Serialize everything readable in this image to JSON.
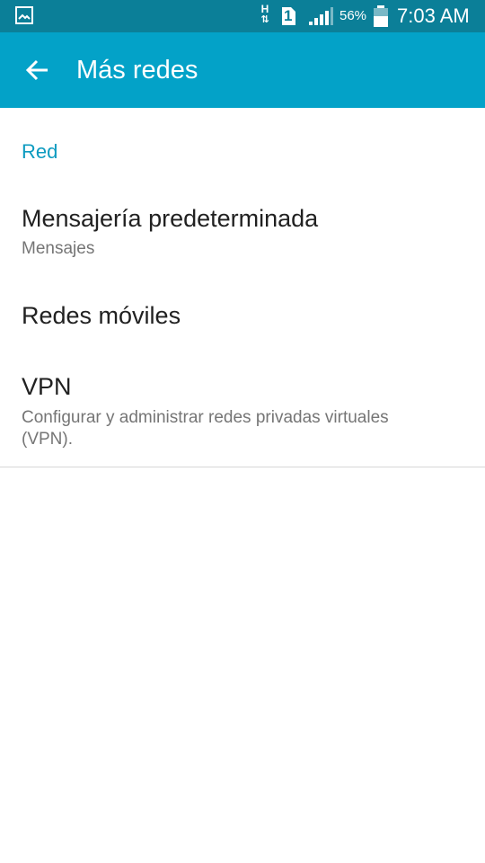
{
  "status_bar": {
    "left_icon": "gallery-notification-icon",
    "network_type": "H",
    "sim_slot": "1",
    "battery_percent": "56%",
    "time": "7:03 AM"
  },
  "app_bar": {
    "title": "Más redes",
    "back_icon": "arrow-left-icon"
  },
  "section": {
    "header": "Red"
  },
  "preferences": [
    {
      "title": "Mensajería predeterminada",
      "summary": "Mensajes"
    },
    {
      "title": "Redes móviles",
      "summary": ""
    },
    {
      "title": "VPN",
      "summary": "Configurar y administrar redes privadas virtuales (VPN)."
    }
  ],
  "colors": {
    "status_bar": "#0b7f98",
    "app_bar": "#03a2c8",
    "accent": "#0d9bc0"
  }
}
